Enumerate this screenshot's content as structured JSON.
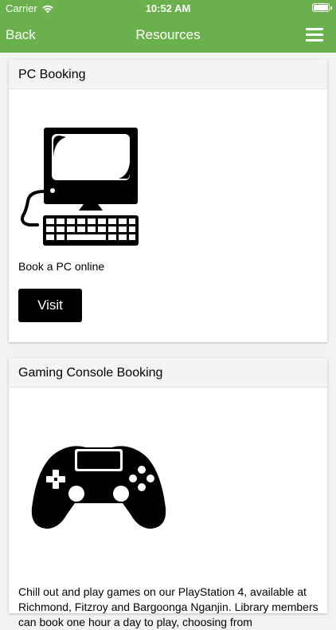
{
  "status_bar": {
    "carrier": "Carrier",
    "time": "10:52 AM"
  },
  "nav": {
    "back_label": "Back",
    "title": "Resources"
  },
  "cards": [
    {
      "title": "PC Booking",
      "image_icon": "desktop-computer-icon",
      "description": "Book a PC online",
      "button_label": "Visit"
    },
    {
      "title": "Gaming Console Booking",
      "image_icon": "game-controller-icon",
      "description": "Chill out and play games on our PlayStation 4, available at Richmond, Fitzroy and Bargoonga Nganjin. Library members can book one hour a day to play, choosing from"
    }
  ],
  "colors": {
    "header": "#6ab04c",
    "button": "#000000",
    "card_header": "#f4f4f4"
  }
}
